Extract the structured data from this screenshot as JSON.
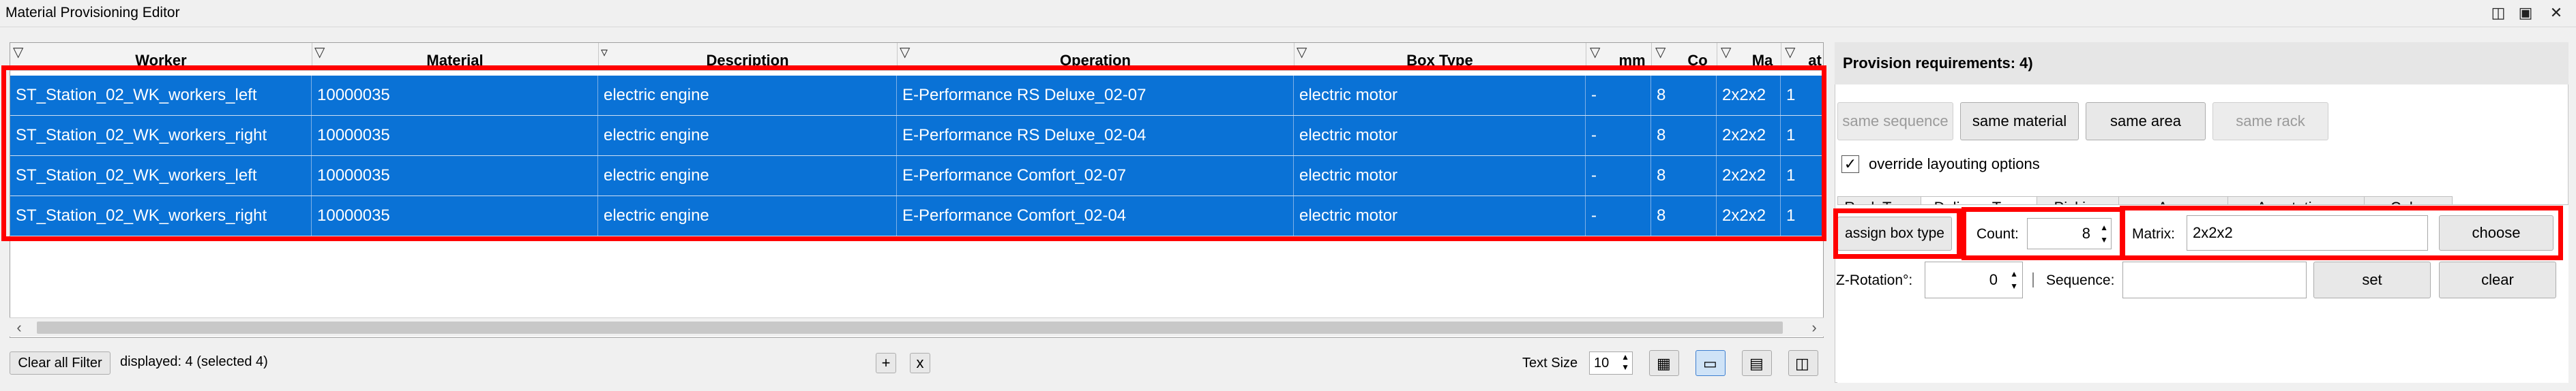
{
  "window": {
    "title": "Material Provisioning Editor"
  },
  "table": {
    "columns": [
      "Worker",
      "Material",
      "Description",
      "Operation",
      "Box Type",
      "mm",
      "Co",
      "Ma",
      "at"
    ],
    "rows": [
      [
        "ST_Station_02_WK_workers_left",
        "10000035",
        "electric engine",
        "E-Performance RS Deluxe_02-07",
        "electric motor",
        "-",
        "8",
        "2x2x2",
        "1"
      ],
      [
        "ST_Station_02_WK_workers_right",
        "10000035",
        "electric engine",
        "E-Performance RS Deluxe_02-04",
        "electric motor",
        "-",
        "8",
        "2x2x2",
        "1"
      ],
      [
        "ST_Station_02_WK_workers_left",
        "10000035",
        "electric engine",
        "E-Performance Comfort_02-07",
        "electric motor",
        "-",
        "8",
        "2x2x2",
        "1"
      ],
      [
        "ST_Station_02_WK_workers_right",
        "10000035",
        "electric engine",
        "E-Performance Comfort_02-04",
        "electric motor",
        "-",
        "8",
        "2x2x2",
        "1"
      ]
    ]
  },
  "footer": {
    "clear_filter": "Clear all Filter",
    "displayed": "displayed: 4 (selected 4)",
    "add": "+",
    "remove": "x",
    "text_size_label": "Text Size",
    "text_size_value": "10"
  },
  "panel": {
    "title": "Provision requirements: 4)",
    "buttons": {
      "same_sequence": "same sequence",
      "same_material": "same material",
      "same_area": "same area",
      "same_rack": "same rack"
    },
    "override_label": "override layouting options",
    "override_checked": true,
    "tabs": [
      "Rack Type",
      "Delivery Type",
      "Picking",
      "Area",
      "Annotations",
      "Color"
    ],
    "assign_box_type": "assign box type",
    "count_label": "Count:",
    "count_value": "8",
    "matrix_label": "Matrix:",
    "matrix_value": "2x2x2",
    "choose": "choose",
    "zrot_label": "Z-Rotation°:",
    "zrot_value": "0",
    "sequence_label": "Sequence:",
    "sequence_value": "",
    "set": "set",
    "clear": "clear"
  }
}
